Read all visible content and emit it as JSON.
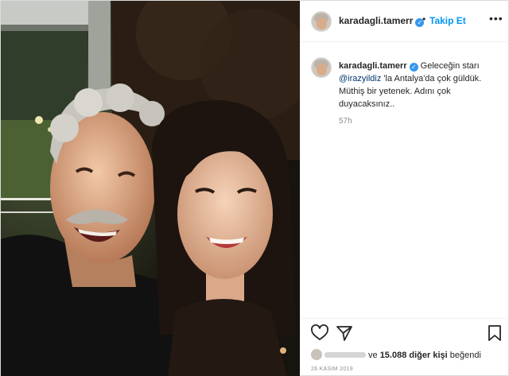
{
  "post": {
    "author": {
      "username": "karadagli.tamerr",
      "verified": true,
      "follow_label": "Takip Et",
      "separator": "•",
      "more_label": "•••"
    },
    "caption": {
      "username": "karadagli.tamerr",
      "text_before": " Geleceğin starı ",
      "mention": "@irazyildiz",
      "text_after": " 'la Antalya'da çok güldük. Müthiş bir yetenek. Adını çok duyacaksınız..",
      "time": "57h"
    },
    "likes": {
      "suffix": "ve",
      "count_text": "15.088 diğer kişi",
      "verb": "beğendi"
    },
    "date": "26 KASIM 2019"
  },
  "colors": {
    "accent": "#0095f6",
    "mention": "#00376b",
    "verified": "#3897f0",
    "muted": "#8e8e8e"
  },
  "icons": [
    "heart-icon",
    "share-icon",
    "bookmark-icon",
    "verified-icon",
    "more-icon"
  ]
}
